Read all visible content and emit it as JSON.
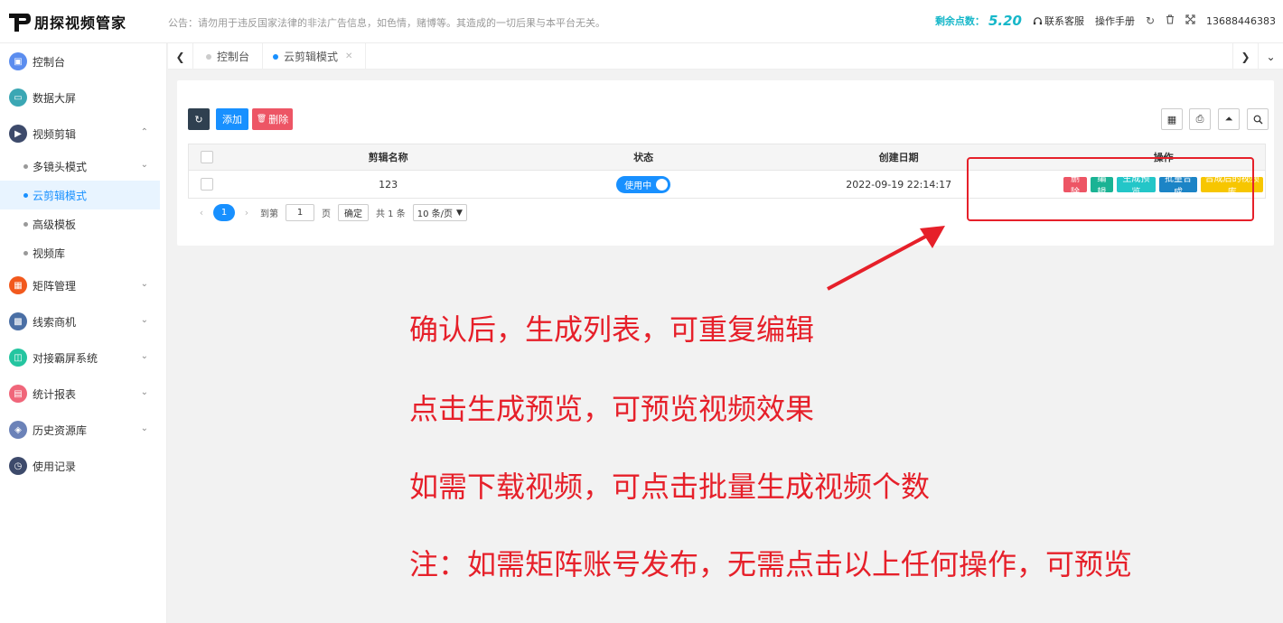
{
  "header": {
    "logo_text": "朋探视频管家",
    "notice": "公告：请勿用于违反国家法律的非法广告信息，如色情，赌博等。其造成的一切后果与本平台无关。",
    "points_label": "剩余点数：",
    "points_value": "5.20",
    "support": "联系客服",
    "manual": "操作手册",
    "account": "13688446383"
  },
  "sidebar": {
    "items": [
      {
        "label": "控制台",
        "icon": "monitor-icon",
        "color": "#5b8def"
      },
      {
        "label": "数据大屏",
        "icon": "screen-icon",
        "color": "#3ba7b4"
      },
      {
        "label": "视频剪辑",
        "icon": "video-edit-icon",
        "color": "#3d4a6b"
      },
      {
        "label": "矩阵管理",
        "icon": "grid-icon",
        "color": "#f2591d"
      },
      {
        "label": "线索商机",
        "icon": "chart-icon",
        "color": "#4a6fa5"
      },
      {
        "label": "对接霸屏系统",
        "icon": "layers-icon",
        "color": "#24c5a0"
      },
      {
        "label": "统计报表",
        "icon": "bar-chart-icon",
        "color": "#f0667a"
      },
      {
        "label": "历史资源库",
        "icon": "stack-icon",
        "color": "#6b82b8"
      },
      {
        "label": "使用记录",
        "icon": "clock-icon",
        "color": "#3d4a6b"
      }
    ],
    "subitems": [
      {
        "label": "多镜头模式"
      },
      {
        "label": "云剪辑模式"
      },
      {
        "label": "高级模板"
      },
      {
        "label": "视频库"
      }
    ]
  },
  "tabs": [
    {
      "label": "控制台"
    },
    {
      "label": "云剪辑模式"
    }
  ],
  "toolbar": {
    "add_label": "添加",
    "delete_label": "删除"
  },
  "table": {
    "headers": [
      "剪辑名称",
      "状态",
      "创建日期",
      "操作"
    ],
    "rows": [
      {
        "name": "123",
        "status": "使用中",
        "created": "2022-09-19 22:14:17"
      }
    ],
    "actions": [
      "删除",
      "编辑",
      "生成预览",
      "批量合成",
      "合成后的视频库"
    ]
  },
  "pager": {
    "current": "1",
    "goto_label": "到第",
    "goto_value": "1",
    "page_unit": "页",
    "confirm": "确定",
    "total": "共 1 条",
    "page_size": "10 条/页"
  },
  "notes": [
    "确认后，生成列表，可重复编辑",
    "点击生成预览，可预览视频效果",
    "如需下载视频，可点击批量生成视频个数",
    "注：如需矩阵账号发布，无需点击以上任何操作，可预览"
  ],
  "colors": {
    "accent": "#1890ff",
    "annotation": "#e6202a",
    "points": "#16b7c9"
  }
}
